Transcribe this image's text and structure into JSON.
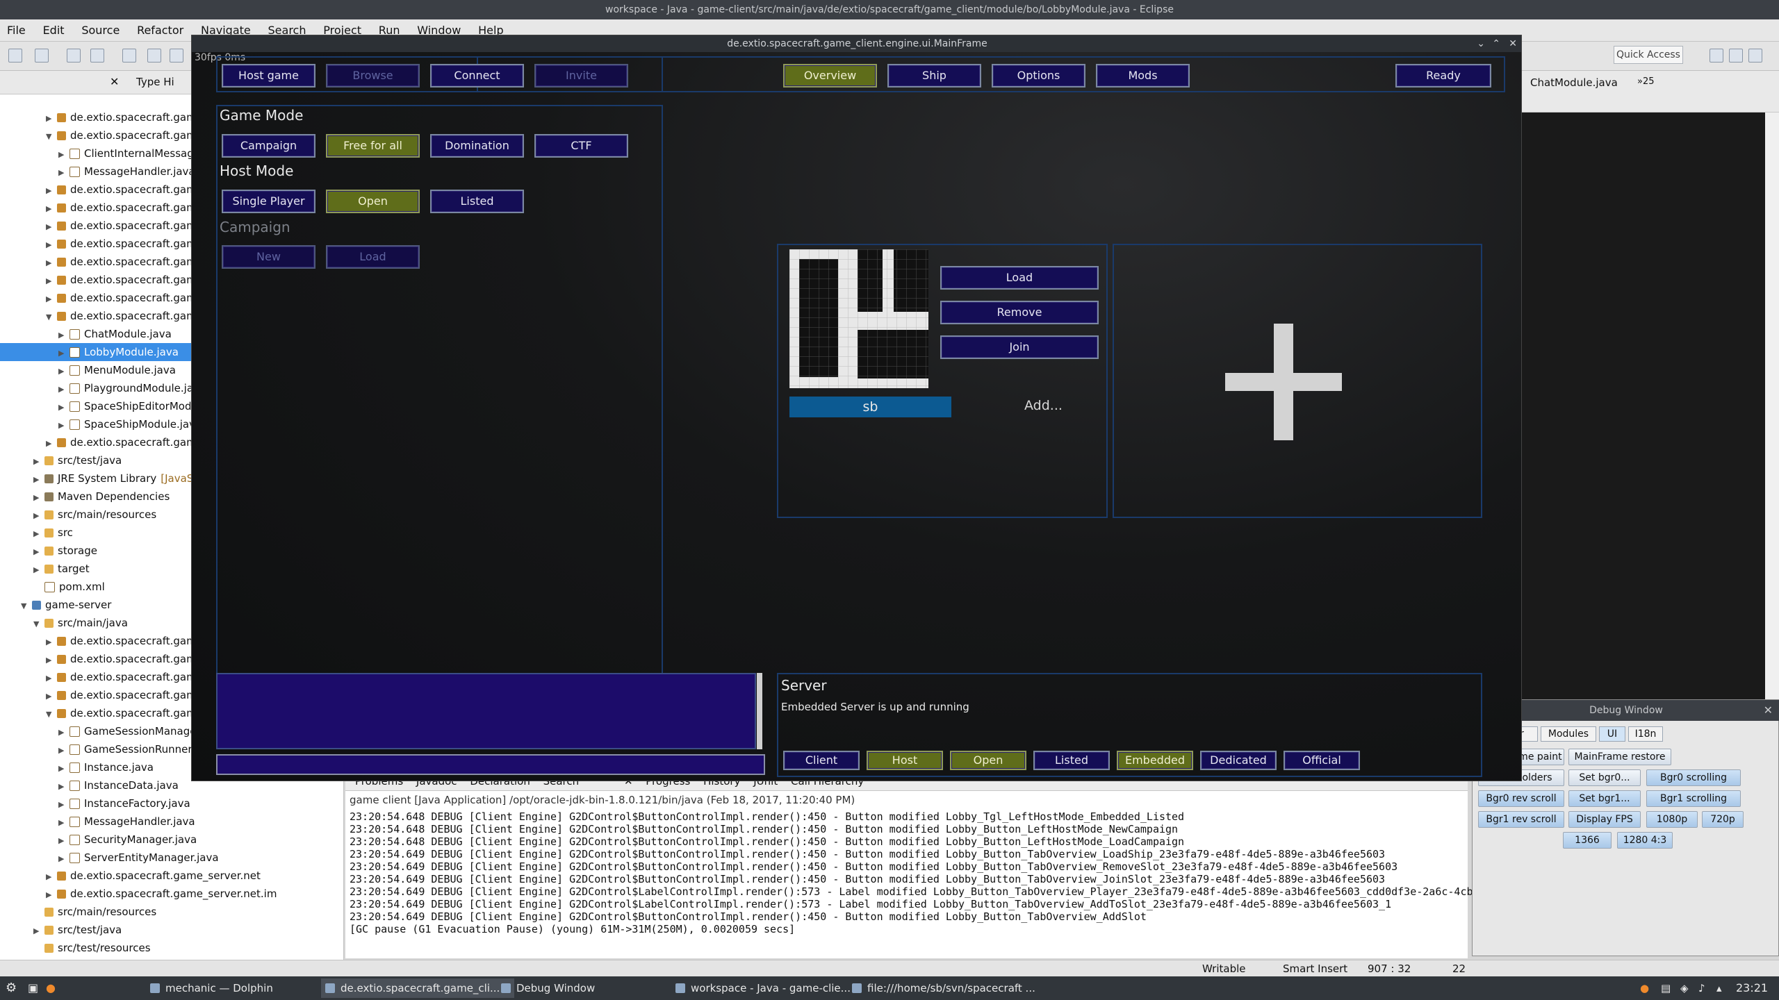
{
  "window": {
    "title": "workspace - Java - game-client/src/main/java/de/extio/spacecraft/game_client/module/bo/LobbyModule.java - Eclipse"
  },
  "menu": [
    "File",
    "Edit",
    "Source",
    "Refactor",
    "Navigate",
    "Search",
    "Project",
    "Run",
    "Window",
    "Help"
  ],
  "toolbar": {
    "quick_access": "Quick Access"
  },
  "explorer": {
    "tabs": [
      "Type Hi"
    ],
    "rows": [
      "de.extio.spacecraft.game",
      "de.extio.spacecraft.game",
      "ClientInternalMessage",
      "MessageHandler.java",
      "de.extio.spacecraft.game",
      "de.extio.spacecraft.game",
      "de.extio.spacecraft.game",
      "de.extio.spacecraft.game",
      "de.extio.spacecraft.game",
      "de.extio.spacecraft.game",
      "de.extio.spacecraft.game",
      "de.extio.spacecraft.game",
      "ChatModule.java",
      "LobbyModule.java",
      "MenuModule.java",
      "PlaygroundModule.java",
      "SpaceShipEditorModu",
      "SpaceShipModule.java",
      "de.extio.spacecraft.game",
      "src/test/java",
      "JRE System Library",
      "Maven Dependencies",
      "src/main/resources",
      "src",
      "storage",
      "target",
      "pom.xml",
      "game-server",
      "src/main/java",
      "de.extio.spacecraft.game",
      "de.extio.spacecraft.game",
      "de.extio.spacecraft.game",
      "de.extio.spacecraft.game",
      "de.extio.spacecraft.game",
      "GameSessionManager",
      "GameSessionRunner.ja",
      "Instance.java",
      "InstanceData.java",
      "InstanceFactory.java",
      "MessageHandler.java",
      "SecurityManager.java",
      "ServerEntityManager.java",
      "de.extio.spacecraft.game_server.net",
      "de.extio.spacecraft.game_server.net.im",
      "src/main/resources",
      "src/test/java",
      "src/test/resources"
    ],
    "jre_suffix": "[JavaSE-"
  },
  "editor": {
    "tab": "ChatModule.java",
    "more": "»25"
  },
  "game": {
    "title": "de.extio.spacecraft.game_client.engine.ui.MainFrame",
    "fps": "30fps 0ms",
    "left_tabs": [
      "Host game",
      "Browse",
      "Connect",
      "Invite"
    ],
    "right_tabs": [
      "Overview",
      "Ship",
      "Options",
      "Mods"
    ],
    "ready": "Ready",
    "game_mode_label": "Game Mode",
    "game_modes": [
      "Campaign",
      "Free for all",
      "Domination",
      "CTF"
    ],
    "host_mode_label": "Host Mode",
    "host_modes": [
      "Single Player",
      "Open",
      "Listed"
    ],
    "campaign_label": "Campaign",
    "campaign_buttons": [
      "New",
      "Load"
    ],
    "ship": {
      "name": "sb",
      "load": "Load",
      "remove": "Remove",
      "join": "Join",
      "add": "Add..."
    },
    "server": {
      "label": "Server",
      "status": "Embedded Server is up and running",
      "buttons": [
        "Client",
        "Host",
        "Open",
        "Listed",
        "Embedded",
        "Dedicated",
        "Official"
      ]
    }
  },
  "console": {
    "tabs": [
      "Problems",
      "Javadoc",
      "Declaration",
      "Search",
      "Progress",
      "History",
      "JUnit",
      "Call Hierarchy"
    ],
    "header": "game client [Java Application] /opt/oracle-jdk-bin-1.8.0.121/bin/java (Feb 18, 2017, 11:20:40 PM)",
    "lines": [
      "23:20:54.648 DEBUG [Client Engine] G2DControl$ButtonControlImpl.render():450 - Button modified Lobby_Tgl_LeftHostMode_Embedded_Listed",
      "23:20:54.648 DEBUG [Client Engine] G2DControl$ButtonControlImpl.render():450 - Button modified Lobby_Button_LeftHostMode_NewCampaign",
      "23:20:54.648 DEBUG [Client Engine] G2DControl$ButtonControlImpl.render():450 - Button modified Lobby_Button_LeftHostMode_LoadCampaign",
      "23:20:54.649 DEBUG [Client Engine] G2DControl$ButtonControlImpl.render():450 - Button modified Lobby_Button_TabOverview_LoadShip_23e3fa79-e48f-4de5-889e-a3b46fee5603",
      "23:20:54.649 DEBUG [Client Engine] G2DControl$ButtonControlImpl.render():450 - Button modified Lobby_Button_TabOverview_RemoveSlot_23e3fa79-e48f-4de5-889e-a3b46fee5603",
      "23:20:54.649 DEBUG [Client Engine] G2DControl$ButtonControlImpl.render():450 - Button modified Lobby_Button_TabOverview_JoinSlot_23e3fa79-e48f-4de5-889e-a3b46fee5603",
      "23:20:54.649 DEBUG [Client Engine] G2DControl$LabelControlImpl.render():573 - Label modified Lobby_Button_TabOverview_Player_23e3fa79-e48f-4de5-889e-a3b46fee5603_cdd0df3e-2a6c-4cb",
      "23:20:54.649 DEBUG [Client Engine] G2DControl$LabelControlImpl.render():573 - Label modified Lobby_Button_TabOverview_AddToSlot_23e3fa79-e48f-4de5-889e-a3b46fee5603_1",
      "23:20:54.649 DEBUG [Client Engine] G2DControl$ButtonControlImpl.render():450 - Button modified Lobby_Button_TabOverview_AddSlot",
      "[GC pause (G1 Evacuation Pause) (young) 61M->31M(250M), 0.0020059 secs]"
    ]
  },
  "status": {
    "writable": "Writable",
    "insert": "Smart Insert",
    "pos": "907 : 32",
    "num": "22"
  },
  "debug": {
    "title": "Debug Window",
    "tabs": [
      "Server",
      "Modules",
      "UI",
      "I18n"
    ],
    "buttons": [
      "MainFrame paint",
      "MainFrame restore",
      "Placeholders",
      "Set bgr0...",
      "Bgr0 scrolling",
      "Bgr0 rev scroll",
      "Set bgr1...",
      "Bgr1 scrolling",
      "Bgr1 rev scroll",
      "Display FPS",
      "1080p",
      "720p",
      "1366",
      "1280 4:3"
    ]
  },
  "taskbar": {
    "items": [
      "mechanic — Dolphin",
      "de.extio.spacecraft.game_cli...",
      "Debug Window",
      "workspace - Java - game-clie...",
      "file:///home/sb/svn/spacecraft ..."
    ],
    "clock": "23:21"
  }
}
